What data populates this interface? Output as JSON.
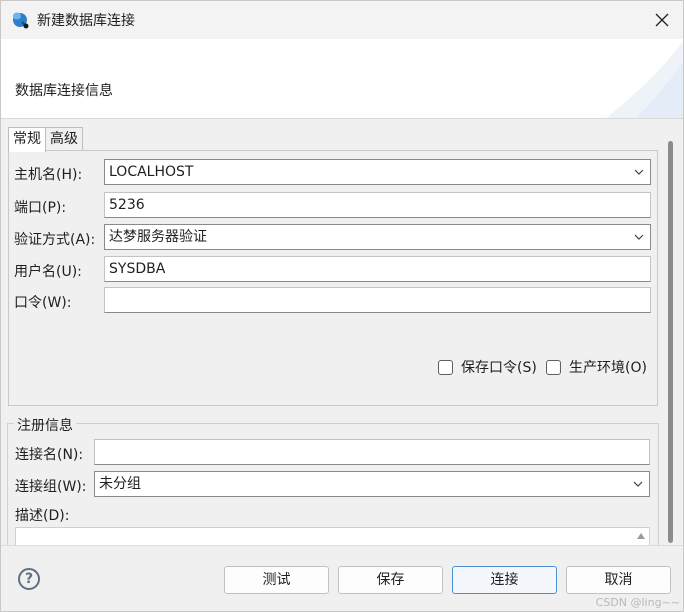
{
  "window": {
    "title": "新建数据库连接",
    "banner_title": "数据库连接信息"
  },
  "tabs": [
    {
      "label": "常规",
      "active": true
    },
    {
      "label": "高级",
      "active": false
    }
  ],
  "general": {
    "host_label": "主机名(H):",
    "host_value": "LOCALHOST",
    "port_label": "端口(P):",
    "port_value": "5236",
    "auth_label": "验证方式(A):",
    "auth_value": "达梦服务器验证",
    "user_label": "用户名(U):",
    "user_value": "SYSDBA",
    "password_label": "口令(W):",
    "password_value": "",
    "save_password_label": "保存口令(S)",
    "save_password_checked": false,
    "production_label": "生产环境(O)",
    "production_checked": false
  },
  "registration": {
    "group_title": "注册信息",
    "conn_name_label": "连接名(N):",
    "conn_name_value": "",
    "conn_group_label": "连接组(W):",
    "conn_group_value": "未分组",
    "desc_label": "描述(D):",
    "desc_value": ""
  },
  "footer": {
    "help_glyph": "?",
    "test_label": "测试",
    "save_label": "保存",
    "connect_label": "连接",
    "cancel_label": "取消"
  },
  "watermark": "CSDN @ling~~",
  "colors": {
    "accent": "#4a90d9",
    "window_bg": "#f0f0f0"
  },
  "icons": {
    "app": "database-connect-icon",
    "close": "close-icon",
    "help": "help-icon",
    "dropdown": "chevron-down-icon"
  }
}
